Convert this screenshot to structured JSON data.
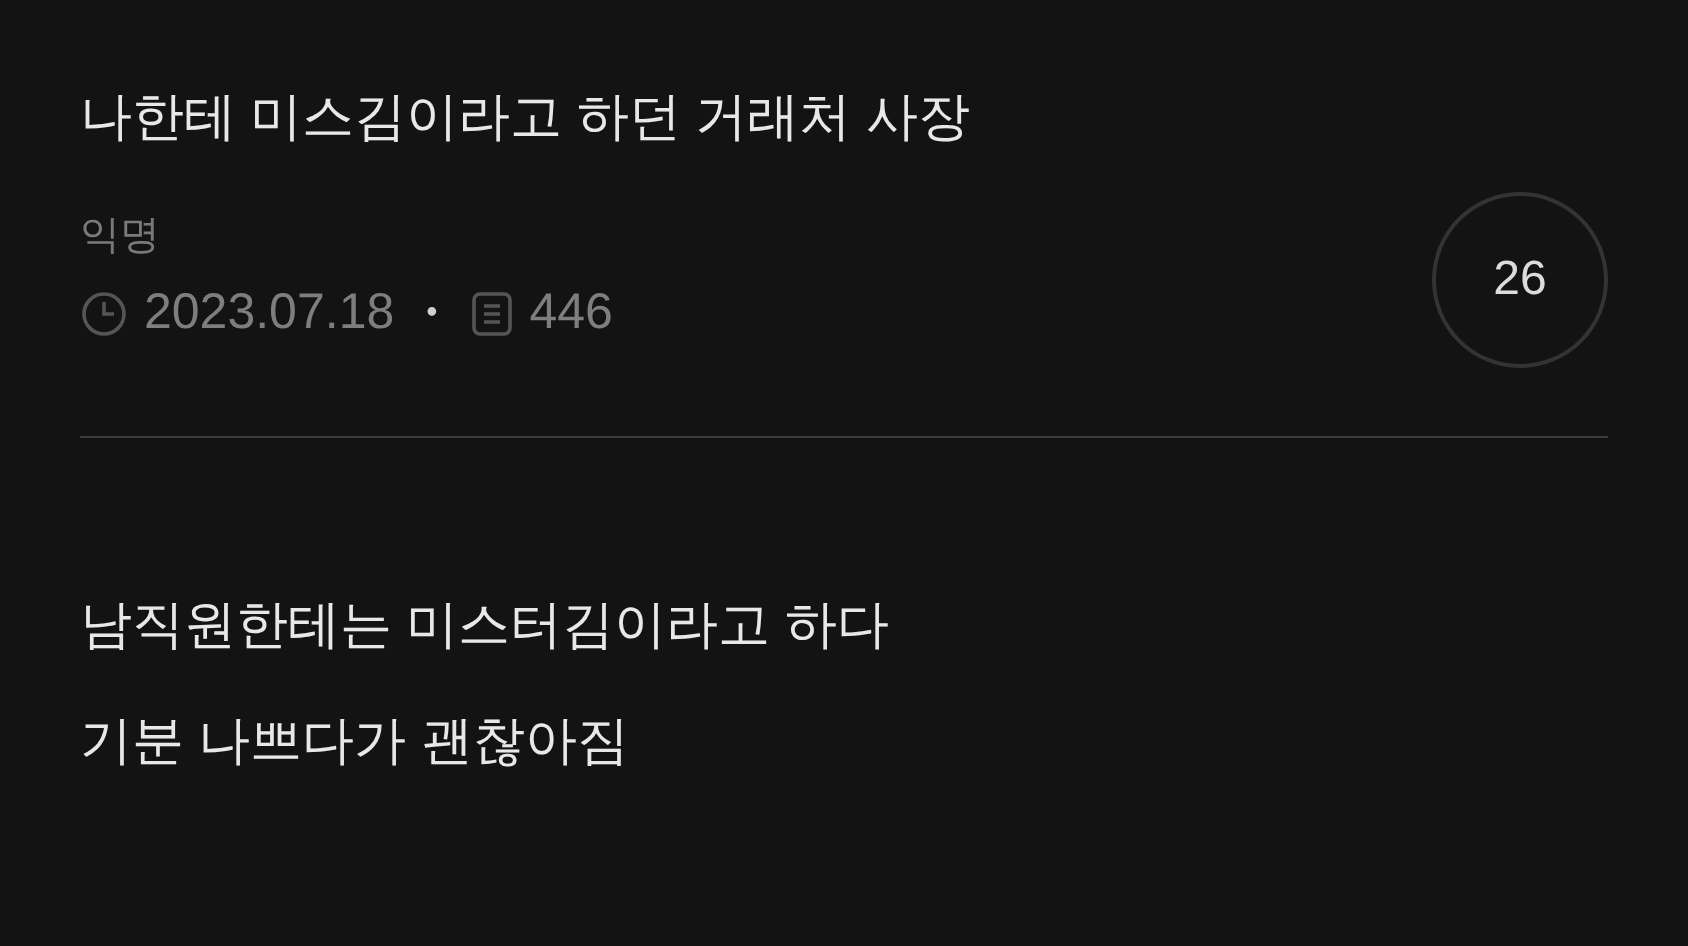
{
  "post": {
    "title": "나한테 미스김이라고 하던 거래처 사장",
    "author": "익명",
    "date": "2023.07.18",
    "separator": "•",
    "views": "446",
    "comment_count": "26",
    "body": [
      "남직원한테는 미스터김이라고 하다",
      "기분 나쁘다가 괜찮아짐"
    ]
  }
}
